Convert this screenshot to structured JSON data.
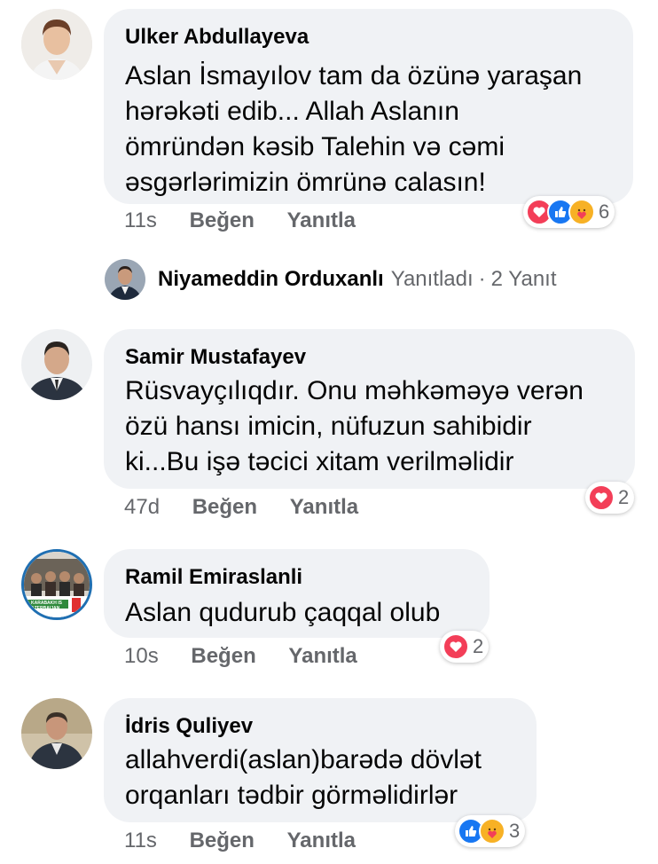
{
  "comments": [
    {
      "author": "Ulker Abdullayeva",
      "text": "Aslan İsmayılov tam da özünə yaraşan\nhərəkəti edib... Allah Aslanın\nömründən kəsib Talehin və cəmi\nəsgərlərimizin ömrünə calasın!",
      "time": "11s",
      "like_label": "Beğen",
      "reply_label": "Yanıtla",
      "reactions": [
        "love",
        "like",
        "care"
      ],
      "reaction_count": "6"
    },
    {
      "author": "Samir Mustafayev",
      "text": "Rüsvayçılıqdır. Onu məhkəməyə verən\nözü hansı imicin, nüfuzun sahibidir\nki...Bu işə təcici xitam verilməlidir",
      "time": "47d",
      "like_label": "Beğen",
      "reply_label": "Yanıtla",
      "reactions": [
        "love"
      ],
      "reaction_count": "2"
    },
    {
      "author": "Ramil Emiraslanli",
      "text": "Aslan qudurub çaqqal olub",
      "time": "10s",
      "like_label": "Beğen",
      "reply_label": "Yanıtla",
      "reactions": [
        "love"
      ],
      "reaction_count": "2",
      "avatar_text": "KARABAKH IS AZERBAIJAN"
    },
    {
      "author": "İdris Quliyev",
      "text": "allahverdi(aslan)barədə dövlət\norqanları tədbir görməlidirlər",
      "time": "11s",
      "like_label": "Beğen",
      "reply_label": "Yanıtla",
      "reactions": [
        "like",
        "care"
      ],
      "reaction_count": "3"
    }
  ],
  "reply_thread": {
    "name": "Niyameddin Orduxanlı",
    "verb": "Yanıtladı",
    "separator": "·",
    "count": "2 Yanıt"
  },
  "colors": {
    "bubble": "#f0f2f5",
    "meta_text": "#65676b",
    "like": "#1877f2",
    "love": "#f33e58",
    "care": "#f7b125"
  },
  "icons": {
    "love": "heart-icon",
    "like": "thumbs-up-icon",
    "care": "care-hug-icon"
  }
}
